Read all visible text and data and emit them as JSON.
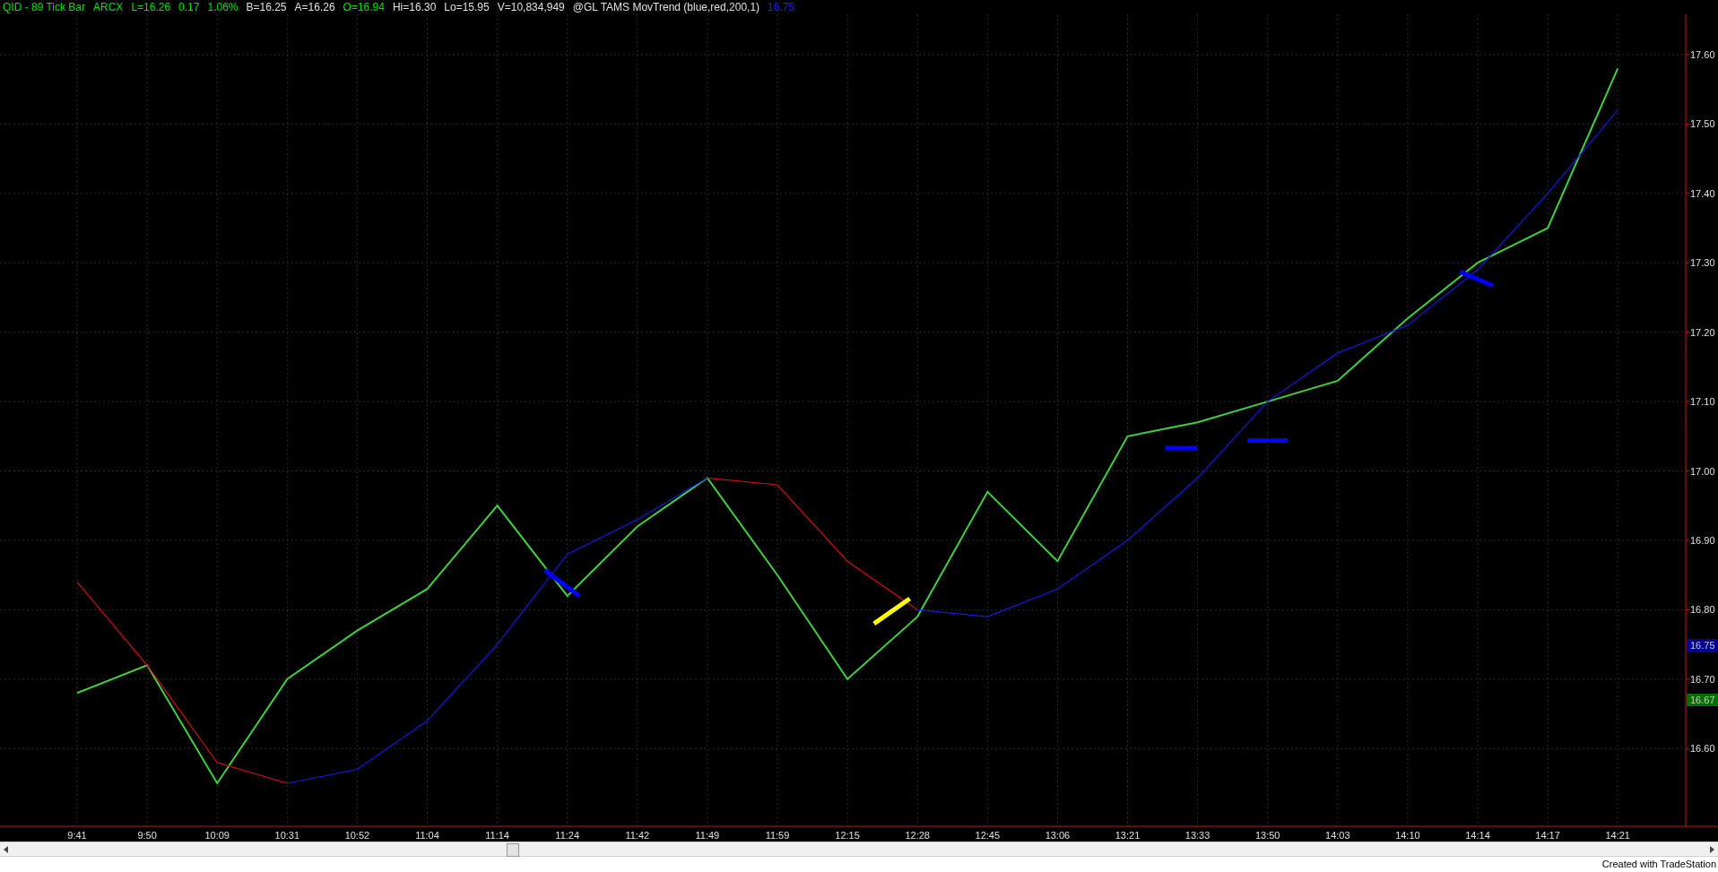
{
  "header": [
    {
      "text": "QID - 89 Tick Bar",
      "color": "#00e000"
    },
    {
      "text": "ARCX",
      "color": "#00e000"
    },
    {
      "text": "L=16.26",
      "color": "#00e000"
    },
    {
      "text": "0.17",
      "color": "#00e000"
    },
    {
      "text": "1.06%",
      "color": "#00e000"
    },
    {
      "text": "B=16.25",
      "color": "#e0e0e0"
    },
    {
      "text": "A=16.26",
      "color": "#e0e0e0"
    },
    {
      "text": "O=16.94",
      "color": "#00e000"
    },
    {
      "text": "Hi=16.30",
      "color": "#e0e0e0"
    },
    {
      "text": "Lo=15.95",
      "color": "#e0e0e0"
    },
    {
      "text": "V=10,834,949",
      "color": "#e0e0e0"
    },
    {
      "text": "@GL TAMS MovTrend (blue,red,200,1)",
      "color": "#e0e0e0"
    },
    {
      "text": "16.75",
      "color": "#2020ff"
    }
  ],
  "chart_data": {
    "type": "line",
    "categories": [
      "9:41",
      "9:50",
      "10:09",
      "10:31",
      "10:52",
      "11:04",
      "11:14",
      "11:24",
      "11:42",
      "11:49",
      "11:59",
      "12:15",
      "12:28",
      "12:45",
      "13:06",
      "13:21",
      "13:33",
      "13:50",
      "14:03",
      "14:10",
      "14:14",
      "14:17",
      "14:21"
    ],
    "ylim": [
      16.488,
      17.658
    ],
    "yticks": [
      {
        "value": 16.6,
        "label": "16.60"
      },
      {
        "value": 16.7,
        "label": "16.70"
      },
      {
        "value": 16.8,
        "label": "16.80"
      },
      {
        "value": 16.9,
        "label": "16.90"
      },
      {
        "value": 17.0,
        "label": "17.00"
      },
      {
        "value": 17.1,
        "label": "17.10"
      },
      {
        "value": 17.2,
        "label": "17.20"
      },
      {
        "value": 17.3,
        "label": "17.30"
      },
      {
        "value": 17.4,
        "label": "17.40"
      },
      {
        "value": 17.5,
        "label": "17.50"
      },
      {
        "value": 17.6,
        "label": "17.60"
      }
    ],
    "grid": true,
    "series": [
      {
        "color": "#40d040",
        "values": [
          16.68,
          16.72,
          16.55,
          16.7,
          16.77,
          16.83,
          16.95,
          16.82,
          16.92,
          16.99,
          16.85,
          16.7,
          16.79,
          16.97,
          16.87,
          17.05,
          17.07,
          17.1,
          17.13,
          17.22,
          17.3,
          17.35,
          17.58
        ]
      },
      {
        "color": "#d01010",
        "values": [
          16.84,
          16.72,
          16.58,
          16.55,
          null,
          null,
          null,
          null,
          null,
          16.99,
          16.98,
          16.87,
          16.8,
          null,
          null,
          null,
          null,
          null,
          null,
          null,
          null,
          null,
          null
        ]
      },
      {
        "color": "#1818e0",
        "values": [
          null,
          null,
          null,
          16.55,
          16.57,
          16.64,
          16.75,
          16.88,
          16.93,
          16.99,
          null,
          null,
          16.8,
          16.79,
          16.83,
          16.9,
          16.99,
          17.1,
          17.17,
          17.21,
          17.29,
          17.4,
          17.52
        ]
      }
    ]
  },
  "price_badges": [
    {
      "label": "16.75",
      "color": "#000090"
    },
    {
      "label": "16.67",
      "color": "#007000"
    }
  ],
  "footer": "Created with TradeStation"
}
